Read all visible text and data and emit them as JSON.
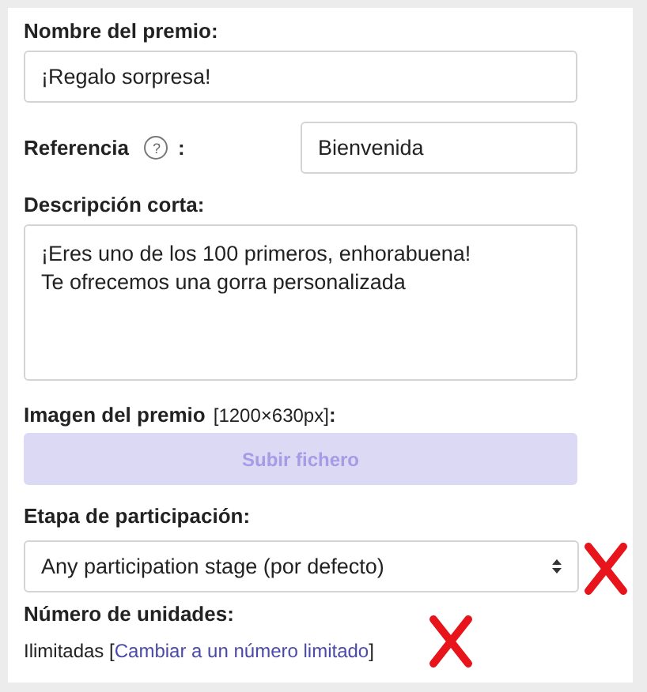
{
  "name_field": {
    "label": "Nombre del premio:",
    "value": "¡Regalo sorpresa!"
  },
  "reference": {
    "label": "Referencia",
    "help_icon": "?",
    "colon": ":",
    "value": "Bienvenida"
  },
  "description": {
    "label": "Descripción corta:",
    "lines": [
      "¡Eres uno de los 100 primeros, enhorabuena!",
      "Te ofrecemos una gorra personalizada"
    ]
  },
  "image": {
    "label": "Imagen del premio",
    "hint": "[1200×630px]",
    "colon": ":",
    "button": "Subir fichero",
    "disabled": true
  },
  "stage": {
    "label": "Etapa de participación:",
    "value": "Any participation stage (por defecto)",
    "flagged": true
  },
  "units": {
    "label": "Número de unidades:",
    "prefix": "Ilimitadas [",
    "link": "Cambiar a un número limitado",
    "suffix": "]",
    "flagged": true
  }
}
